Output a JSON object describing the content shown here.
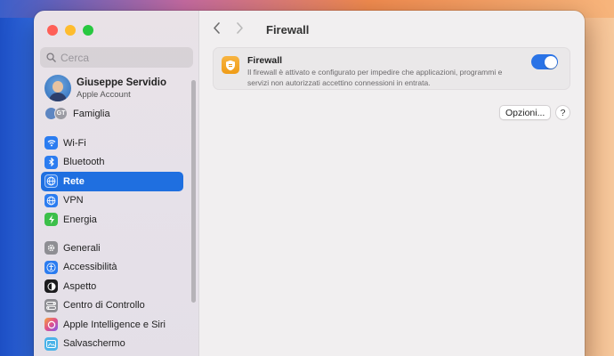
{
  "window": {
    "title": "Firewall"
  },
  "search": {
    "placeholder": "Cerca"
  },
  "account": {
    "name": "Giuseppe Servidio",
    "subtitle": "Apple Account"
  },
  "family": {
    "label": "Famiglia",
    "avatar_initials": "GT"
  },
  "sidebar": {
    "group1": [
      {
        "label": "Wi-Fi",
        "icon": "wifi-icon",
        "color": "#2b7cf0"
      },
      {
        "label": "Bluetooth",
        "icon": "bluetooth-icon",
        "color": "#2b7cf0"
      },
      {
        "label": "Rete",
        "icon": "globe-icon",
        "color": "#2b7cf0",
        "selected": true
      },
      {
        "label": "VPN",
        "icon": "vpn-icon",
        "color": "#2b7cf0"
      },
      {
        "label": "Energia",
        "icon": "energy-icon",
        "color": "#3cbf4a"
      }
    ],
    "group2": [
      {
        "label": "Generali",
        "icon": "gear-icon",
        "color": "#8e8e93"
      },
      {
        "label": "Accessibilità",
        "icon": "accessibility-icon",
        "color": "#2b7cf0"
      },
      {
        "label": "Aspetto",
        "icon": "appearance-icon",
        "color": "#1c1c1e"
      },
      {
        "label": "Centro di Controllo",
        "icon": "control-center-icon",
        "color": "#8e8e93"
      },
      {
        "label": "Apple Intelligence e Siri",
        "icon": "siri-icon",
        "color": "#e0508c"
      },
      {
        "label": "Salvaschermo",
        "icon": "screensaver-icon",
        "color": "#4ab3e8"
      }
    ]
  },
  "firewall": {
    "title": "Firewall",
    "description": "Il firewall è attivato e configurato per impedire che applicazioni, programmi e servizi non autorizzati accettino connessioni in entrata.",
    "enabled": true
  },
  "buttons": {
    "options": "Opzioni...",
    "help": "?"
  }
}
